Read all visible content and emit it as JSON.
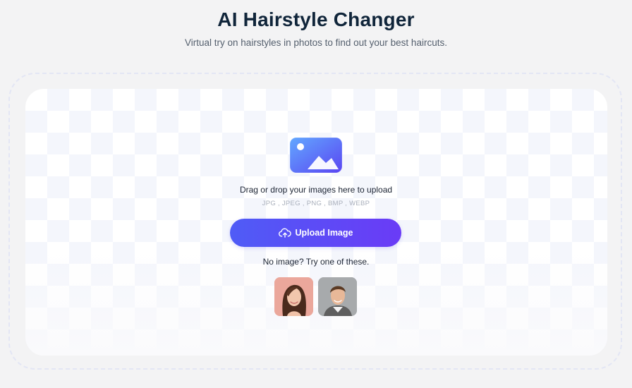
{
  "header": {
    "title": "AI Hairstyle Changer",
    "subtitle": "Virtual try on hairstyles in photos to find out your best haircuts."
  },
  "upload": {
    "icon": "image-icon",
    "drag_text": "Drag or drop your images here to upload",
    "formats": "JPG , JPEG , PNG , BMP , WEBP",
    "button_label": "Upload Image",
    "button_icon": "cloud-upload-icon",
    "button_color_start": "#4f5cf6",
    "button_color_end": "#6a3bf6"
  },
  "samples": {
    "prompt": "No image? Try one of these.",
    "items": [
      {
        "name": "sample-woman",
        "background": "#e9a59a"
      },
      {
        "name": "sample-man",
        "background": "#a4a8ab"
      }
    ]
  }
}
